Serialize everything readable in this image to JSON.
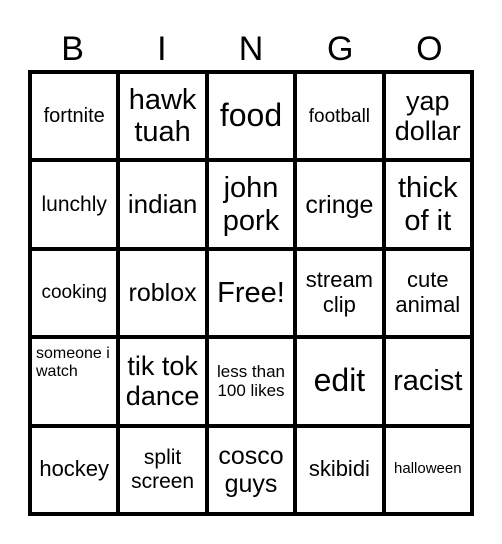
{
  "header": [
    "B",
    "I",
    "N",
    "G",
    "O"
  ],
  "cells": [
    {
      "text": "fortnite",
      "size": 20
    },
    {
      "text": "hawk tuah",
      "size": 29
    },
    {
      "text": "food",
      "size": 32
    },
    {
      "text": "football",
      "size": 19
    },
    {
      "text": "yap dollar",
      "size": 27
    },
    {
      "text": "lunchly",
      "size": 21
    },
    {
      "text": "indian",
      "size": 26
    },
    {
      "text": "john pork",
      "size": 29
    },
    {
      "text": "cringe",
      "size": 25
    },
    {
      "text": "thick of it",
      "size": 29
    },
    {
      "text": "cooking",
      "size": 19
    },
    {
      "text": "roblox",
      "size": 25
    },
    {
      "text": "Free!",
      "size": 29
    },
    {
      "text": "stream clip",
      "size": 22
    },
    {
      "text": "cute animal",
      "size": 22
    },
    {
      "text": "someone i watch",
      "size": 16,
      "align": "topleft"
    },
    {
      "text": "tik tok dance",
      "size": 27
    },
    {
      "text": "less than 100 likes",
      "size": 17
    },
    {
      "text": "edit",
      "size": 32
    },
    {
      "text": "racist",
      "size": 29
    },
    {
      "text": "hockey",
      "size": 22
    },
    {
      "text": "split screen",
      "size": 21
    },
    {
      "text": "cosco guys",
      "size": 25
    },
    {
      "text": "skibidi",
      "size": 22
    },
    {
      "text": "halloween",
      "size": 15
    }
  ]
}
